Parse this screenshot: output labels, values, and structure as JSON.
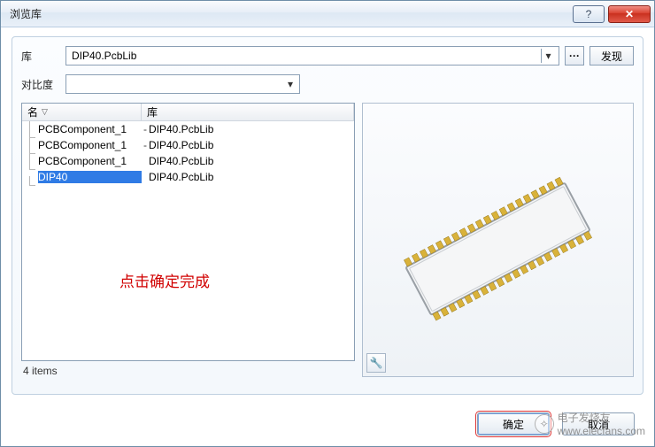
{
  "window": {
    "title": "浏览库"
  },
  "library": {
    "label": "库",
    "selected": "DIP40.PcbLib",
    "find_label": "发现"
  },
  "contrast": {
    "label": "对比度",
    "value": ""
  },
  "columns": {
    "name": "名",
    "lib": "库"
  },
  "rows": [
    {
      "name": "PCBComponent_1",
      "lib": "DIP40.PcbLib",
      "selected": false
    },
    {
      "name": "PCBComponent_1",
      "lib": "DIP40.PcbLib",
      "selected": false
    },
    {
      "name": "PCBComponent_1",
      "lib": "DIP40.PcbLib",
      "selected": false
    },
    {
      "name": "DIP40",
      "lib": "DIP40.PcbLib",
      "selected": true
    }
  ],
  "count_text": "4 items",
  "annotation": "点击确定完成",
  "buttons": {
    "ok": "确定",
    "cancel": "取消"
  },
  "watermark": {
    "brand": "电子发烧友",
    "url": "www.elecfans.com"
  }
}
